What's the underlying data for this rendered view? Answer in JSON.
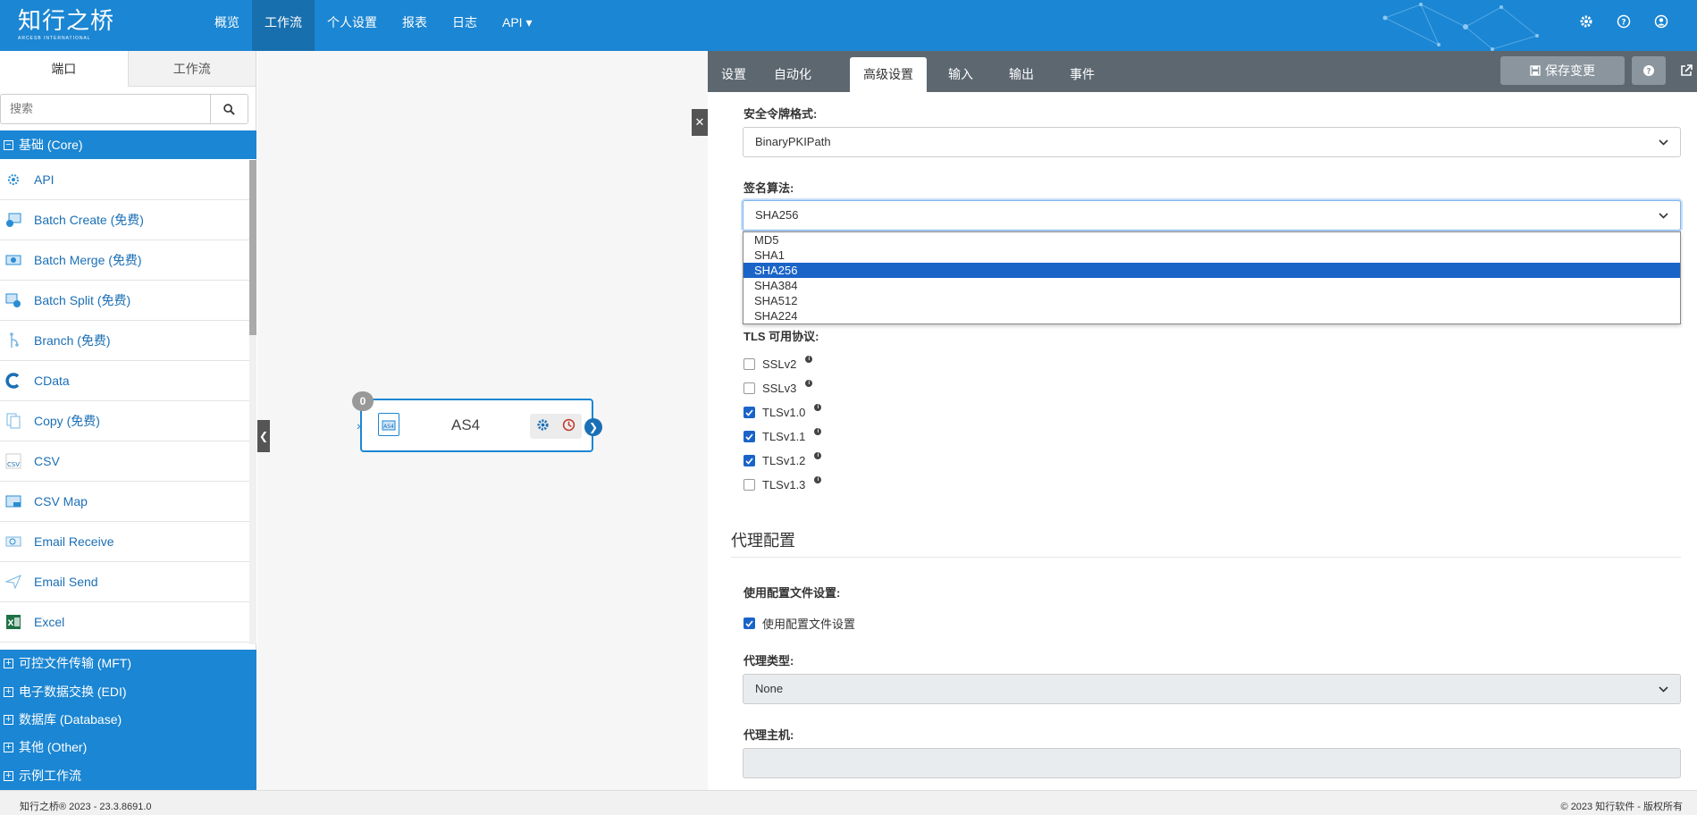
{
  "app": {
    "logo_text": "知行之桥",
    "logo_sub": "ARCESB INTERNATIONAL"
  },
  "nav": {
    "items": [
      {
        "label": "概览",
        "active": false
      },
      {
        "label": "工作流",
        "active": true
      },
      {
        "label": "个人设置",
        "active": false
      },
      {
        "label": "报表",
        "active": false
      },
      {
        "label": "日志",
        "active": false
      },
      {
        "label": "API ▾",
        "active": false
      }
    ],
    "icons": [
      "gear-icon",
      "help-icon",
      "user-icon"
    ]
  },
  "left": {
    "tabs": [
      "端口",
      "工作流"
    ],
    "search_placeholder": "搜索",
    "core_category": "基础 (Core)",
    "connectors": [
      {
        "label": "API",
        "icon": "api-icon"
      },
      {
        "label": "Batch Create (免费)",
        "icon": "batch-create-icon"
      },
      {
        "label": "Batch Merge (免费)",
        "icon": "batch-merge-icon"
      },
      {
        "label": "Batch Split (免费)",
        "icon": "batch-split-icon"
      },
      {
        "label": "Branch (免费)",
        "icon": "branch-icon"
      },
      {
        "label": "CData",
        "icon": "cdata-icon"
      },
      {
        "label": "Copy (免费)",
        "icon": "copy-icon"
      },
      {
        "label": "CSV",
        "icon": "csv-icon"
      },
      {
        "label": "CSV Map",
        "icon": "csv-map-icon"
      },
      {
        "label": "Email Receive",
        "icon": "email-receive-icon"
      },
      {
        "label": "Email Send",
        "icon": "email-send-icon"
      },
      {
        "label": "Excel",
        "icon": "excel-icon"
      }
    ],
    "other_categories": [
      "可控文件传输 (MFT)",
      "电子数据交换 (EDI)",
      "数据库 (Database)",
      "其他 (Other)",
      "示例工作流"
    ]
  },
  "canvas": {
    "node": {
      "title": "AS4",
      "badge": "0"
    }
  },
  "right": {
    "tabs": [
      {
        "label": "设置",
        "active": false
      },
      {
        "label": "自动化",
        "active": false
      },
      {
        "label": "高级设置",
        "active": true
      },
      {
        "label": "输入",
        "active": false
      },
      {
        "label": "输出",
        "active": false
      },
      {
        "label": "事件",
        "active": false
      }
    ],
    "save_label": "保存变更",
    "token_format_label": "安全令牌格式:",
    "token_format_value": "BinaryPKIPath",
    "sign_algo_label": "签名算法:",
    "sign_algo_value": "SHA256",
    "sign_algo_options": [
      "MD5",
      "SHA1",
      "SHA256",
      "SHA384",
      "SHA512",
      "SHA224"
    ],
    "sign_algo_selected": "SHA256",
    "tls_label": "TLS 可用协议:",
    "tls_options": [
      {
        "label": "SSLv2",
        "checked": false
      },
      {
        "label": "SSLv3",
        "checked": false
      },
      {
        "label": "TLSv1.0",
        "checked": true
      },
      {
        "label": "TLSv1.1",
        "checked": true
      },
      {
        "label": "TLSv1.2",
        "checked": true
      },
      {
        "label": "TLSv1.3",
        "checked": false
      }
    ],
    "proxy_section_title": "代理配置",
    "use_profile_label": "使用配置文件设置:",
    "use_profile_checkbox": "使用配置文件设置",
    "use_profile_checked": true,
    "proxy_type_label": "代理类型:",
    "proxy_type_value": "None",
    "proxy_host_label": "代理主机:",
    "proxy_host_value": ""
  },
  "footer": {
    "left": "知行之桥® 2023 - 23.3.8691.0",
    "right": "© 2023 知行软件 - 版权所有"
  },
  "colors": {
    "brand": "#1b86d3",
    "tab_bar": "#5c6770",
    "selection": "#1a64c8"
  }
}
